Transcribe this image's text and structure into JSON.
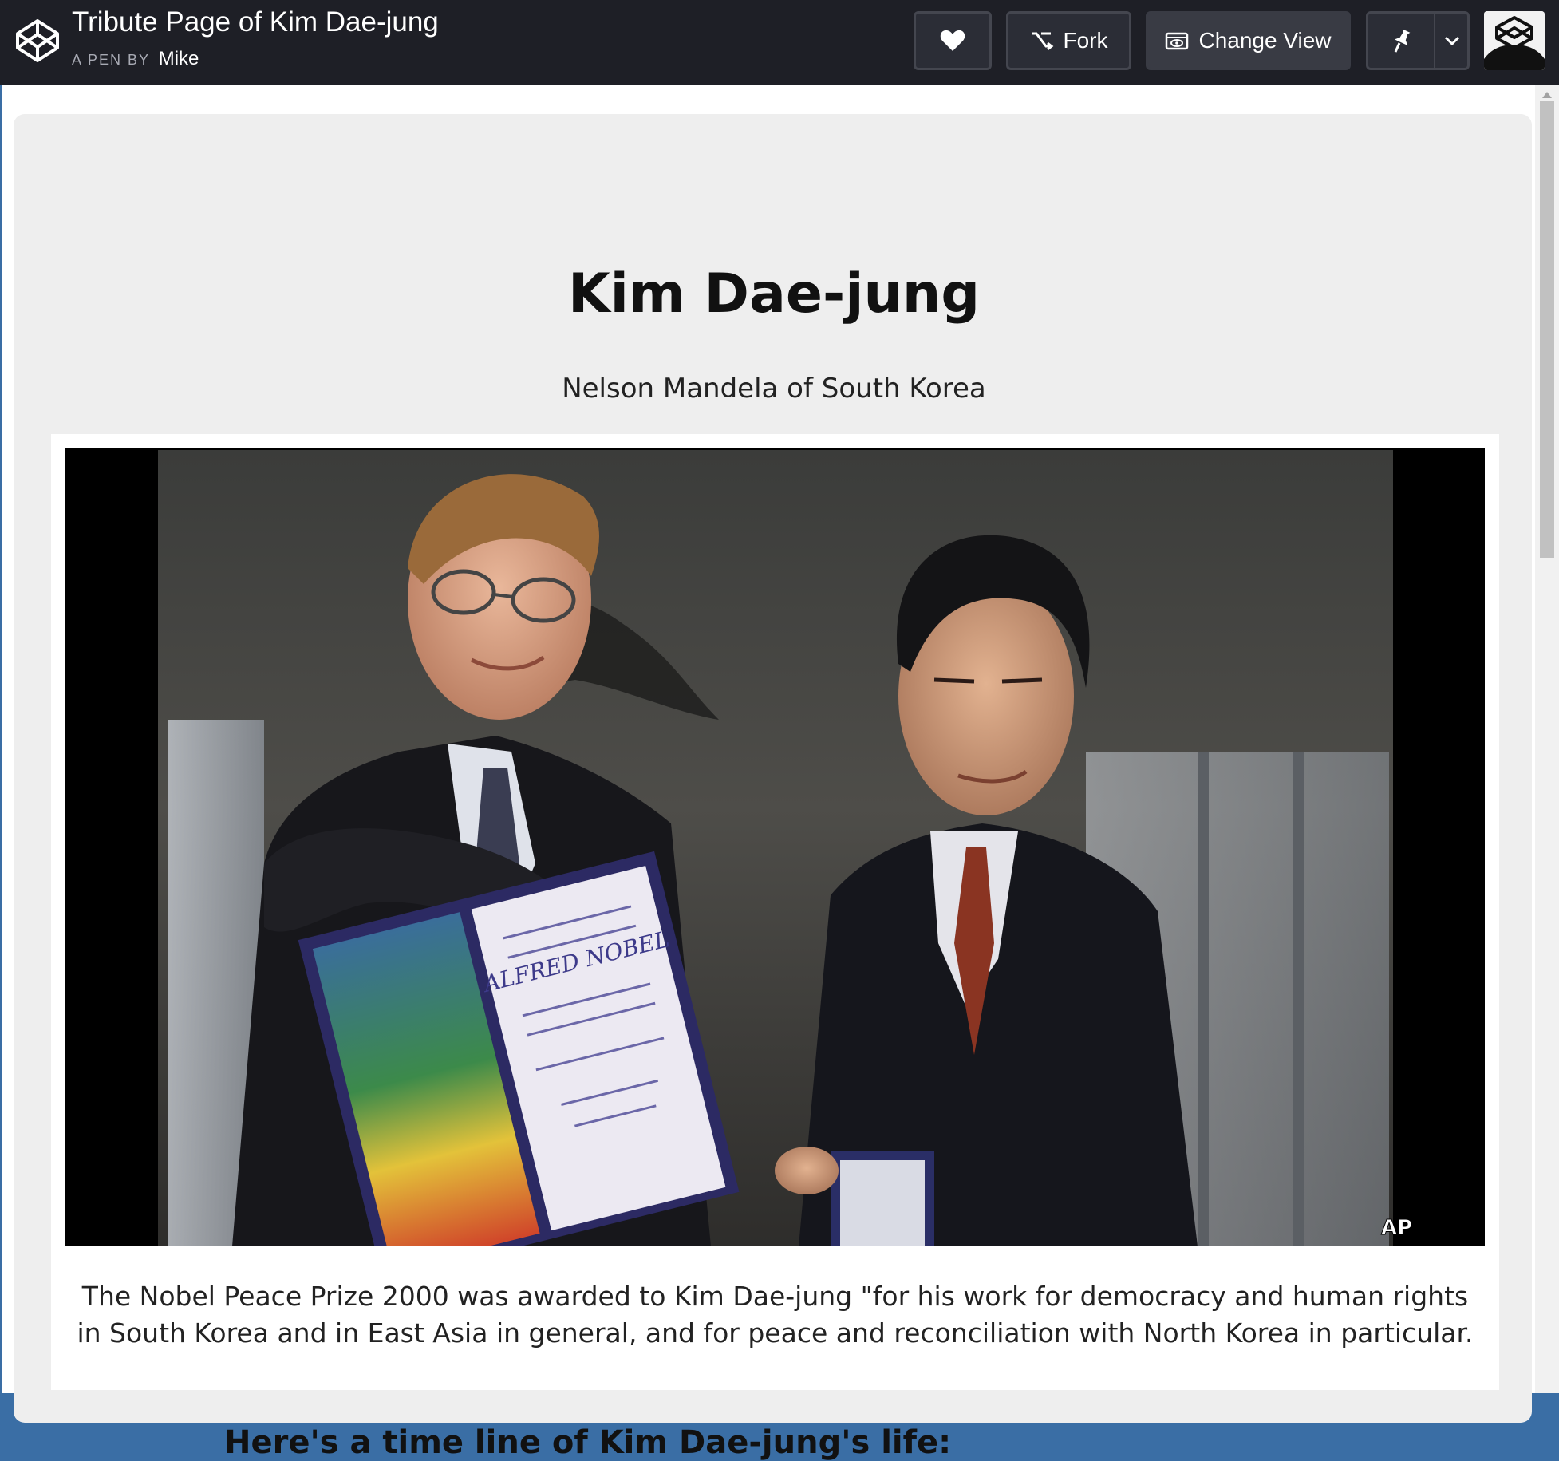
{
  "header": {
    "pen_title": "Tribute Page of Kim Dae-jung",
    "pen_by_label": "A PEN BY",
    "author": "Mike",
    "logo_icon": "codepen-logo-icon",
    "buttons": {
      "heart_icon": "heart-icon",
      "fork_label": "Fork",
      "fork_icon": "fork-icon",
      "change_view_label": "Change View",
      "change_view_icon": "eye-window-icon",
      "pin_icon": "pin-icon",
      "caret_icon": "chevron-down-icon"
    },
    "avatar": "user-avatar"
  },
  "page": {
    "title": "Kim Dae-jung",
    "subtitle": "Nelson Mandela of South Korea",
    "photo": {
      "watermark": "AP",
      "diploma_text": "ALFRED NOBEL"
    },
    "caption": "The Nobel Peace Prize 2000 was awarded to Kim Dae-jung \"for his work for democracy and human rights in South Korea and in East Asia in general, and for peace and reconciliation with North Korea in particular.",
    "timeline_heading": "Here's a time line of Kim Dae-jung's life:"
  },
  "colors": {
    "header_bg": "#1e1f26",
    "page_bg": "#eeeeee",
    "button_bg": "#2b2d36",
    "button_border": "#44464f"
  }
}
